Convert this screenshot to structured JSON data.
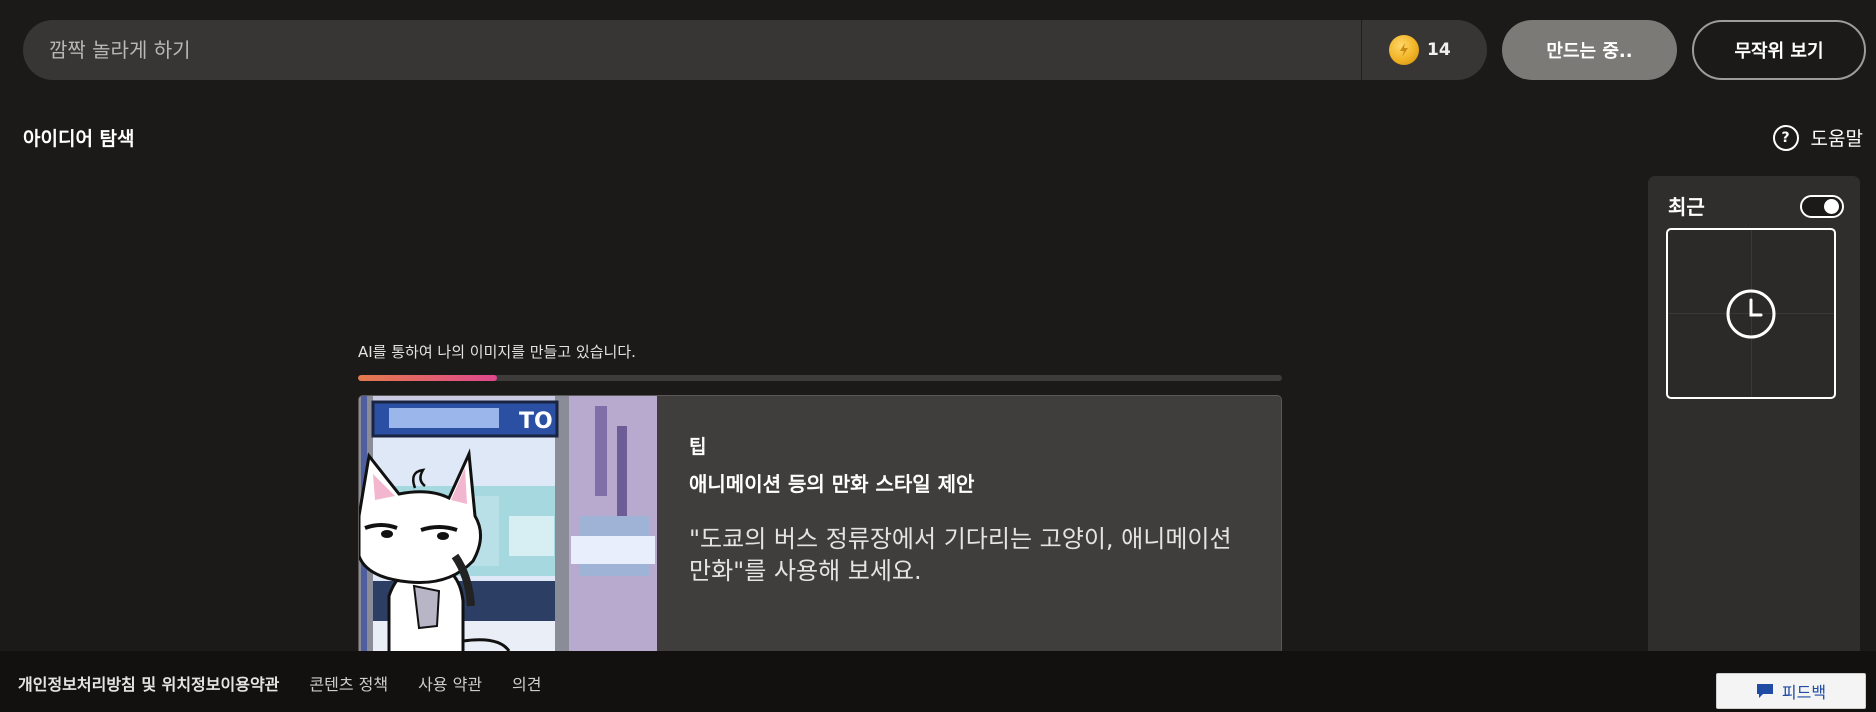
{
  "prompt": {
    "placeholder": "깜짝 놀라게 하기"
  },
  "boosts": {
    "count": "14",
    "icon": "coin-icon"
  },
  "buttons": {
    "create_label": "만드는 중..",
    "random_label": "무작위 보기"
  },
  "section": {
    "title": "아이디어 탐색",
    "help_label": "도움말"
  },
  "progress": {
    "text": "AI를 통하여 나의 이미지를 만들고 있습니다.",
    "fraction": 0.15,
    "colors": [
      "#e47a4c",
      "#e0488e"
    ]
  },
  "tip": {
    "label": "팁",
    "heading": "애니메이션 등의 만화 스타일 제안",
    "body": "\"도쿄의 버스 정류장에서 기다리는 고양이, 애니메이션 만화\"를 사용해 보세요.",
    "image_sign_text": "TO"
  },
  "recent": {
    "title": "최근",
    "toggle_on": true,
    "placeholder_icon": "clock-icon"
  },
  "footer": {
    "links": [
      "개인정보처리방침 및 위치정보이용약관",
      "콘텐츠 정책",
      "사용 약관",
      "의견"
    ],
    "feedback_label": "피드백"
  }
}
